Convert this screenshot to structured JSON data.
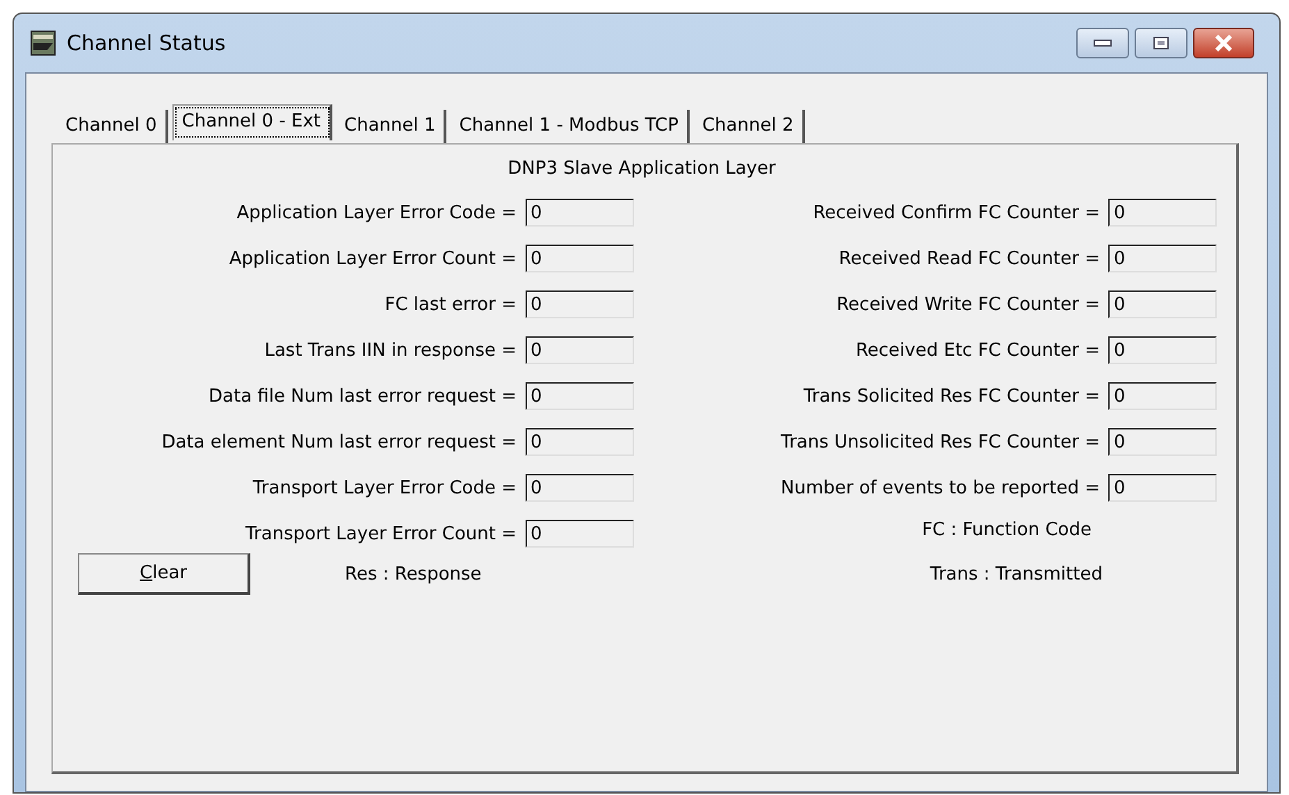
{
  "window": {
    "title": "Channel Status"
  },
  "tabs": [
    {
      "label": "Channel 0",
      "selected": false
    },
    {
      "label": "Channel 0 - Ext",
      "selected": true
    },
    {
      "label": "Channel 1",
      "selected": false
    },
    {
      "label": "Channel 1 - Modbus TCP",
      "selected": false
    },
    {
      "label": "Channel 2",
      "selected": false
    }
  ],
  "panel": {
    "heading": "DNP3 Slave Application Layer",
    "left_fields": [
      {
        "label": "Application Layer Error Code =",
        "value": "0"
      },
      {
        "label": "Application Layer Error Count =",
        "value": "0"
      },
      {
        "label": "FC last error =",
        "value": "0"
      },
      {
        "label": "Last Trans IIN in response =",
        "value": "0"
      },
      {
        "label": "Data file Num last error request =",
        "value": "0"
      },
      {
        "label": "Data element Num last error request =",
        "value": "0"
      },
      {
        "label": "Transport Layer Error Code =",
        "value": "0"
      },
      {
        "label": "Transport Layer Error Count =",
        "value": "0"
      }
    ],
    "right_fields": [
      {
        "label": "Received Confirm FC Counter =",
        "value": "0"
      },
      {
        "label": "Received Read FC Counter =",
        "value": "0"
      },
      {
        "label": "Received Write FC Counter =",
        "value": "0"
      },
      {
        "label": "Received Etc FC Counter =",
        "value": "0"
      },
      {
        "label": "Trans Solicited Res FC Counter =",
        "value": "0"
      },
      {
        "label": "Trans Unsolicited Res FC Counter =",
        "value": "0"
      },
      {
        "label": "Number of events to be reported =",
        "value": "0"
      }
    ],
    "right_note": "FC : Function Code",
    "clear_button": "Clear",
    "left_legend": "Res : Response",
    "right_legend": "Trans : Transmitted"
  }
}
